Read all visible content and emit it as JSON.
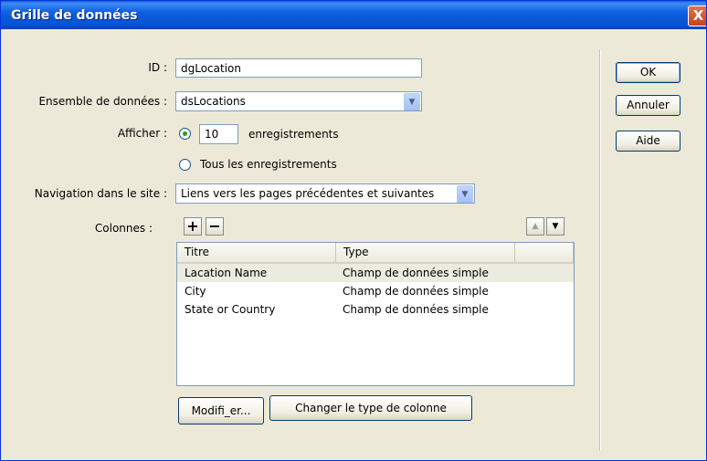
{
  "window": {
    "title": "Grille de données",
    "close_glyph": "X"
  },
  "form": {
    "id_label": "ID :",
    "id_value": "dgLocation",
    "dataset_label": "Ensemble de données :",
    "dataset_value": "dsLocations",
    "show_label": "Afficher :",
    "show_count": "10",
    "show_unit": "enregistrements",
    "show_all_label": "Tous les enregistrements",
    "show_mode": "count",
    "nav_label": "Navigation dans le site :",
    "nav_value": "Liens vers les pages précédentes et suivantes",
    "columns_label": "Colonnes :"
  },
  "columns_table": {
    "headers": [
      "Titre",
      "Type"
    ],
    "rows": [
      {
        "title": "Lacation Name",
        "type": "Champ de données simple",
        "selected": true
      },
      {
        "title": "City",
        "type": "Champ de données simple",
        "selected": false
      },
      {
        "title": "State or Country",
        "type": "Champ de données simple",
        "selected": false
      }
    ]
  },
  "toolbar": {
    "add_glyph": "+",
    "remove_glyph": "−",
    "up_glyph": "▲",
    "down_glyph": "▼"
  },
  "buttons": {
    "modify": "Modifi_er...",
    "change_type": "Changer le type de colonne",
    "ok": "OK",
    "cancel": "Annuler",
    "help": "Aide"
  },
  "icons": {
    "add": "plus-icon",
    "remove": "minus-icon",
    "move_up": "arrow-up-icon",
    "move_down": "arrow-down-icon",
    "dropdown": "chevron-down-icon",
    "close": "close-icon"
  },
  "colors": {
    "titlebar": "#0752d2",
    "dialog_bg": "#ece9d8",
    "close": "#c6421d",
    "radio_dot": "#21a121"
  }
}
